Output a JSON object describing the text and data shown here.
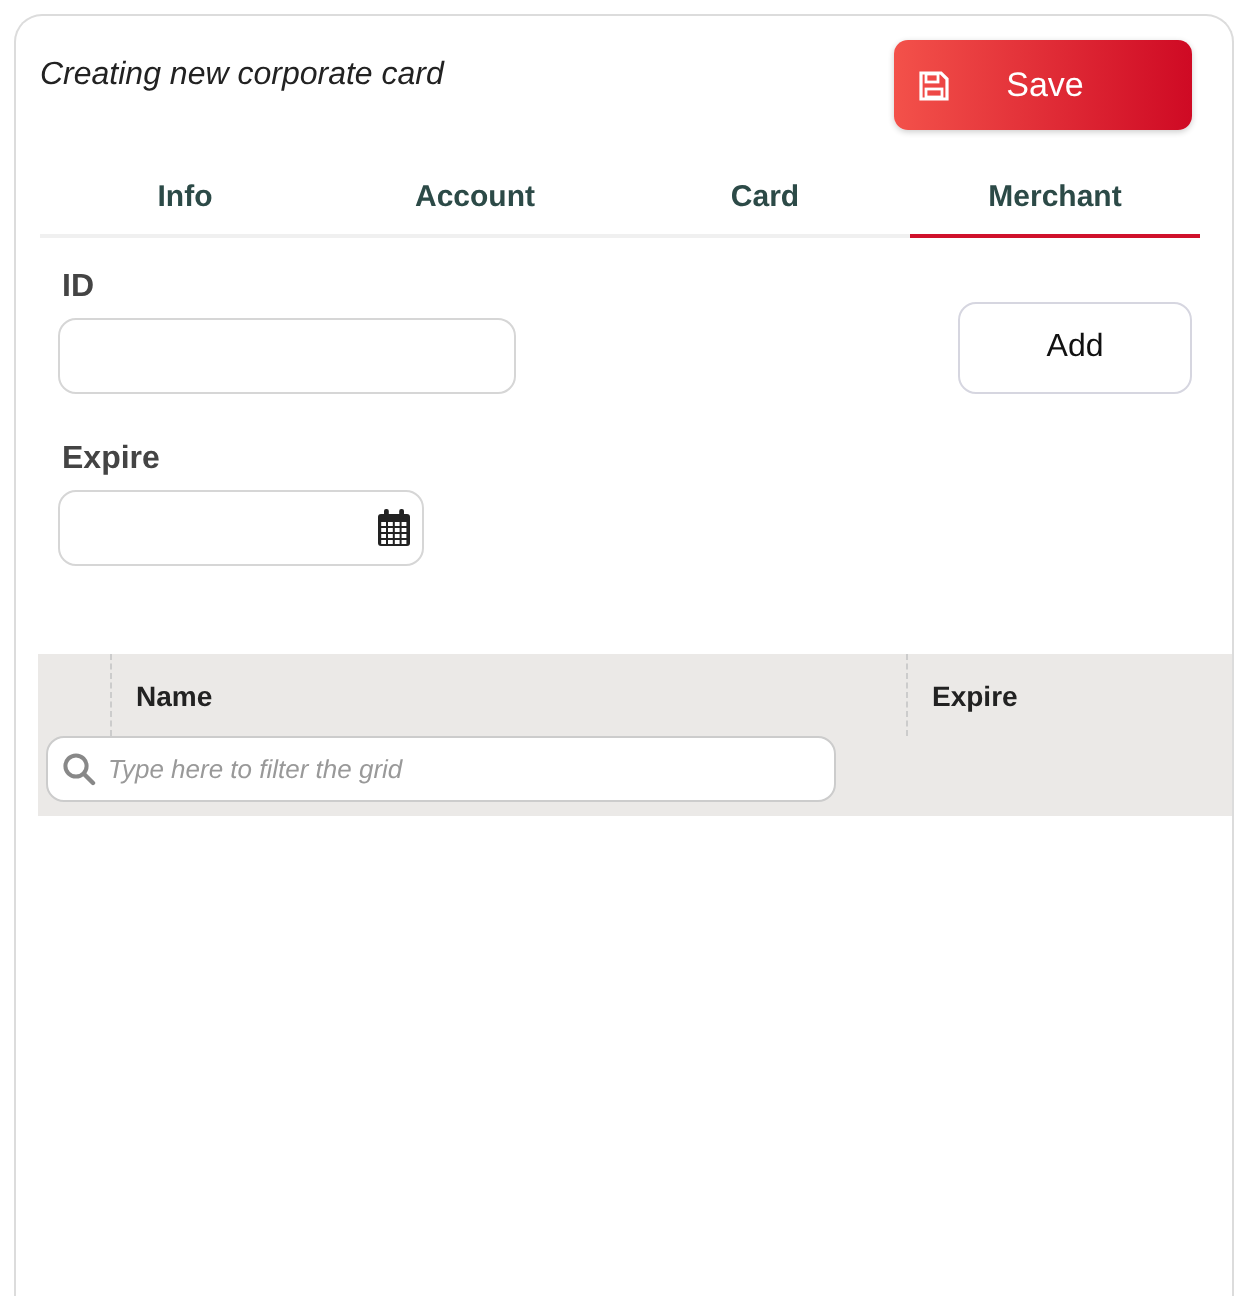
{
  "title": "Creating new corporate card",
  "save_button": {
    "label": "Save"
  },
  "tabs": [
    {
      "label": "Info",
      "selected": false
    },
    {
      "label": "Account",
      "selected": false
    },
    {
      "label": "Card",
      "selected": false
    },
    {
      "label": "Merchant",
      "selected": true
    }
  ],
  "fields": [
    {
      "label": "ID",
      "kind": "text"
    },
    {
      "label": "Expire",
      "kind": "date"
    }
  ],
  "add_button": {
    "label": "Add"
  },
  "grid": {
    "columns": [
      "Name",
      "Expire"
    ],
    "filter": {
      "placeholder": "Type here to filter the grid"
    }
  }
}
